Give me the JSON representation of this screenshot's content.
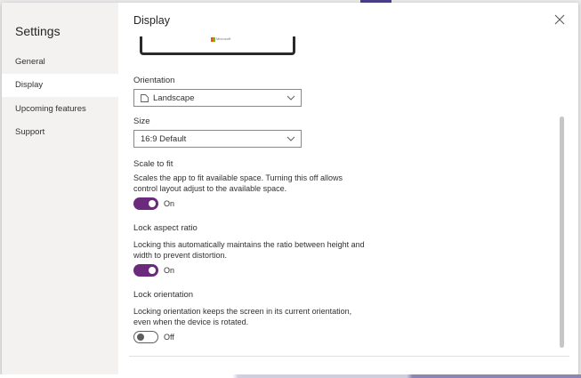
{
  "sidebar": {
    "title": "Settings",
    "items": [
      {
        "label": "General"
      },
      {
        "label": "Display"
      },
      {
        "label": "Upcoming features"
      },
      {
        "label": "Support"
      }
    ],
    "active_index": 1
  },
  "main": {
    "title": "Display",
    "preview": {
      "logo_text": "Microsoft"
    },
    "orientation": {
      "label": "Orientation",
      "value": "Landscape"
    },
    "size": {
      "label": "Size",
      "value": "16:9 Default"
    },
    "scale_to_fit": {
      "label": "Scale to fit",
      "description": "Scales the app to fit available space. Turning this off allows control layout adjust to the available space.",
      "state": "On"
    },
    "lock_aspect_ratio": {
      "label": "Lock aspect ratio",
      "description": "Locking this automatically maintains the ratio between height and width to prevent distortion.",
      "state": "On"
    },
    "lock_orientation": {
      "label": "Lock orientation",
      "description": "Locking orientation keeps the screen in its current orientation, even when the device is rotated.",
      "state": "Off"
    }
  },
  "colors": {
    "toggle_on": "#6b2a7c",
    "sidebar_bg": "#f3f2f1",
    "accent_strip": "#4b3f8a"
  },
  "icons": {
    "close": "close-icon",
    "chevron": "chevron-down-icon",
    "orientation": "landscape-icon"
  }
}
